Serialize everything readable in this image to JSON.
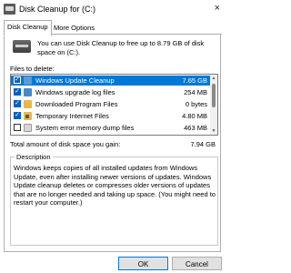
{
  "window": {
    "title": "Disk Cleanup for  (C:)",
    "close_glyph": "×",
    "icon": "disk-cleanup-icon"
  },
  "tabs": [
    {
      "label": "Disk Cleanup",
      "active": true
    },
    {
      "label": "More Options",
      "active": false
    }
  ],
  "intro": {
    "text": "You can use Disk Cleanup to free up to 8.79 GB of disk space on  (C:).",
    "icon": "drive-icon"
  },
  "files_label": "Files to delete:",
  "files": [
    {
      "name": "Windows Update Cleanup",
      "size": "7.65 GB",
      "checked": true,
      "selected": true,
      "icon": "update-icon"
    },
    {
      "name": "Windows upgrade log files",
      "size": "254 MB",
      "checked": true,
      "selected": false,
      "icon": "log-icon"
    },
    {
      "name": "Downloaded Program Files",
      "size": "0 bytes",
      "checked": true,
      "selected": false,
      "icon": "folder-icon"
    },
    {
      "name": "Temporary Internet Files",
      "size": "4.80 MB",
      "checked": true,
      "selected": false,
      "icon": "lock-folder-icon"
    },
    {
      "name": "System error memory dump files",
      "size": "463 MB",
      "checked": false,
      "selected": false,
      "icon": "dump-file-icon"
    }
  ],
  "total": {
    "label": "Total amount of disk space you gain:",
    "value": "7.94 GB"
  },
  "description": {
    "title": "Description",
    "text": "Windows keeps copies of all installed updates from Windows Update, even after installing newer versions of updates. Windows Update cleanup deletes or compresses older versions of updates that are no longer needed and taking up space. (You might need to restart your computer.)"
  },
  "buttons": {
    "ok": "OK",
    "cancel": "Cancel"
  },
  "colors": {
    "selection": "#0078d7",
    "checkbox": "#0062c4"
  }
}
